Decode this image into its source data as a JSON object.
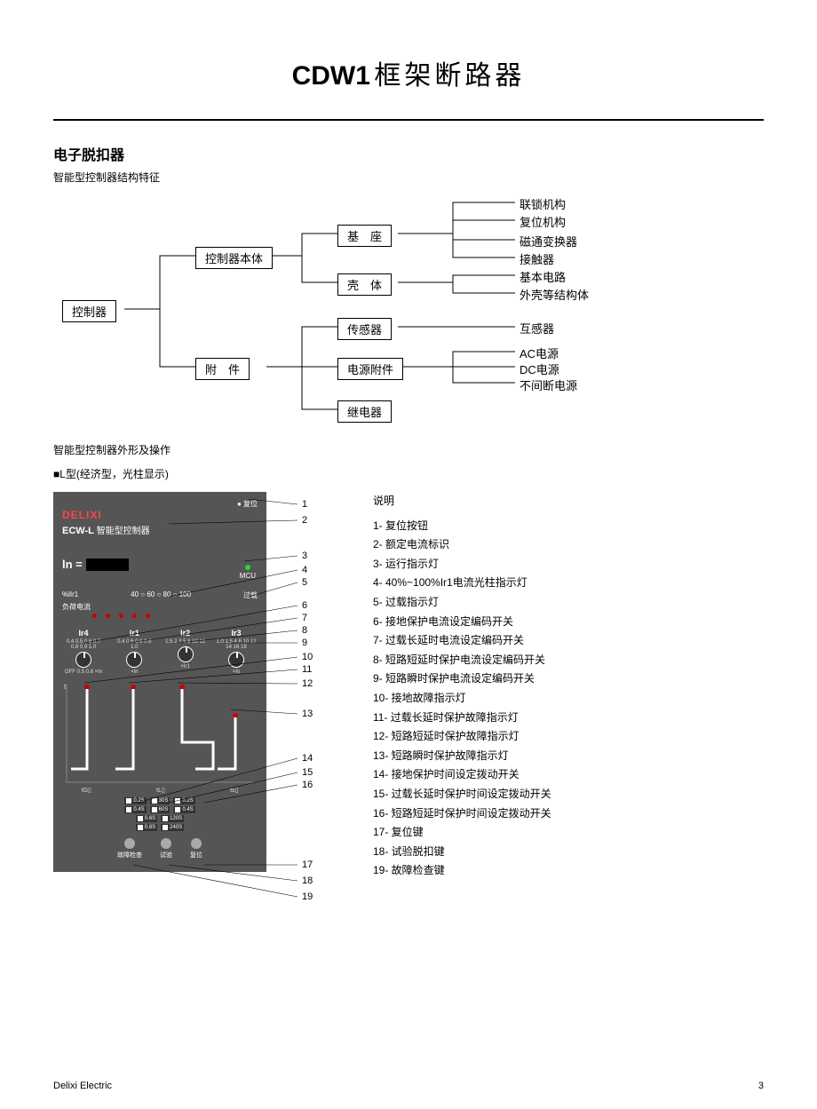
{
  "header": {
    "bold": "CDW1",
    "light": "框架断路器"
  },
  "section1": {
    "title": "电子脱扣器",
    "caption": "智能型控制器结构特征"
  },
  "tree": {
    "root": "控制器",
    "n1": "控制器本体",
    "n2": "附　件",
    "n11": "基　座",
    "n12": "壳　体",
    "n21": "传感器",
    "n22": "电源附件",
    "n23": "继电器",
    "leaves": {
      "l1": "联锁机构",
      "l2": "复位机构",
      "l3": "磁通变换器",
      "l4": "接触器",
      "l5": "基本电路",
      "l6": "外壳等结构体",
      "l7": "互感器",
      "l8": "AC电源",
      "l9": "DC电源",
      "l10": "不间断电源"
    }
  },
  "section2": {
    "title": "智能型控制器外形及操作",
    "sub": "■L型(经济型，光柱显示)"
  },
  "panel": {
    "reset_top": "● 复位",
    "brand": "DELIXI",
    "model_prefix": "ECW-L",
    "model_suffix": "智能型控制器",
    "ln": "ln =",
    "mcu": "MCU",
    "bar_left": "%lIr1",
    "bar_vals": "40 ○ 60 ○ 80 ○ 100",
    "bar_right": "过载",
    "load_label": "负荷电流",
    "k1": "Ir1",
    "k2": "Ir2",
    "k3": "Ir3",
    "k0": "Ir4",
    "dial0": "0.4 0.5 0.6 0.7 0.8 0.9 1.0",
    "dial0b": "OFF  0.5 0.8  ×In",
    "dial1": "0.4 0.6 0.8 0.9 1.0",
    "dial2": "1.5 2 3 5 8 10 12",
    "dial3": "1.0 1.5 4 8 10 12 14 16 18",
    "xin0": "×In",
    "xin1": "×In",
    "xin2": "×Ir1",
    "xin3": "×In",
    "t_lab": {
      "a": "tG▯",
      "b": "tL▯",
      "c": "ts▯"
    },
    "toggles": [
      [
        "0.2S",
        "30S",
        "0.2S"
      ],
      [
        "0.4S",
        "60S",
        "0.4S"
      ],
      [
        "0.6S",
        "120S",
        ""
      ],
      [
        "0.8S",
        "240S",
        ""
      ]
    ],
    "btn1": "故障检查",
    "btn2": "试验",
    "btn3": "复位",
    "t_axis": "t"
  },
  "legend": {
    "head": "说明",
    "items": [
      "1- 复位按钮",
      "2- 额定电流标识",
      "3- 运行指示灯",
      "4- 40%~100%Ir1电流光柱指示灯",
      "5- 过载指示灯",
      "6- 接地保护电流设定编码开关",
      "7- 过载长延时电流设定编码开关",
      "8- 短路短延时保护电流设定编码开关",
      "9- 短路瞬时保护电流设定编码开关",
      "10- 接地故障指示灯",
      "11- 过载长延时保护故障指示灯",
      "12- 短路短延时保护故障指示灯",
      "13- 短路瞬时保护故障指示灯",
      "14- 接地保护时间设定拨动开关",
      "15- 过载长延时保护时间设定拨动开关",
      "16- 短路短延时保护时间设定拨动开关",
      "17- 复位键",
      "18- 试验脱扣键",
      "19- 故障检查键"
    ]
  },
  "footer": {
    "left": "Delixi Electric",
    "right": "3"
  }
}
